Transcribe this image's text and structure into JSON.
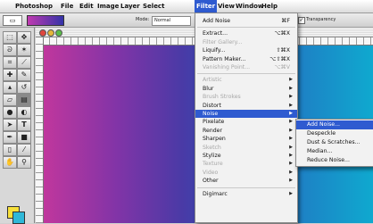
{
  "menubar": {
    "apple_icon": "apple-logo",
    "items": [
      "Photoshop",
      "File",
      "Edit",
      "Image",
      "Layer",
      "Select",
      "Filter",
      "View",
      "Window",
      "Help"
    ],
    "active": "Filter"
  },
  "options_bar": {
    "mode_label": "Mode:",
    "mode_value": "Normal",
    "checkbox_label": "Transparency",
    "checkbox_checked": true,
    "gradient_colors": [
      "#c03ab0",
      "#3433a8"
    ]
  },
  "toolbox": {
    "tool_icons": [
      "marquee-icon",
      "move-icon",
      "lasso-icon",
      "magic-wand-icon",
      "crop-icon",
      "slice-icon",
      "healing-icon",
      "brush-icon",
      "stamp-icon",
      "history-brush-icon",
      "eraser-icon",
      "gradient-icon",
      "blur-icon",
      "dodge-icon",
      "path-select-icon",
      "type-icon",
      "pen-icon",
      "shape-icon",
      "notes-icon",
      "eyedropper-icon",
      "hand-icon",
      "zoom-icon"
    ],
    "foreground_color": "#f7e03a",
    "background_color": "#2fb8d8"
  },
  "canvas": {
    "gradient_colors": [
      "#c0379d",
      "#4a3aa6",
      "#1f7cc4",
      "#0fa9cf"
    ]
  },
  "filter_menu": {
    "items": [
      {
        "label": "Add Noise",
        "shortcut": "⌘F",
        "disabled": false
      },
      {
        "sep": true
      },
      {
        "label": "Extract...",
        "shortcut": "⌥⌘X",
        "disabled": false
      },
      {
        "label": "Filter Gallery...",
        "shortcut": "",
        "disabled": true
      },
      {
        "label": "Liquify...",
        "shortcut": "⇧⌘X",
        "disabled": false
      },
      {
        "label": "Pattern Maker...",
        "shortcut": "⌥⇧⌘X",
        "disabled": false
      },
      {
        "label": "Vanishing Point...",
        "shortcut": "⌥⌘V",
        "disabled": true
      },
      {
        "sep": true
      },
      {
        "label": "Artistic",
        "submenu": true,
        "disabled": true
      },
      {
        "label": "Blur",
        "submenu": true,
        "disabled": false
      },
      {
        "label": "Brush Strokes",
        "submenu": true,
        "disabled": true
      },
      {
        "label": "Distort",
        "submenu": true,
        "disabled": false
      },
      {
        "label": "Noise",
        "submenu": true,
        "disabled": false,
        "highlight": true
      },
      {
        "label": "Pixelate",
        "submenu": true,
        "disabled": false
      },
      {
        "label": "Render",
        "submenu": true,
        "disabled": false
      },
      {
        "label": "Sharpen",
        "submenu": true,
        "disabled": false
      },
      {
        "label": "Sketch",
        "submenu": true,
        "disabled": true
      },
      {
        "label": "Stylize",
        "submenu": true,
        "disabled": false
      },
      {
        "label": "Texture",
        "submenu": true,
        "disabled": true
      },
      {
        "label": "Video",
        "submenu": true,
        "disabled": true
      },
      {
        "label": "Other",
        "submenu": true,
        "disabled": false
      },
      {
        "sep": true
      },
      {
        "label": "Digimarc",
        "submenu": true,
        "disabled": false
      }
    ]
  },
  "noise_submenu": {
    "items": [
      {
        "label": "Add Noise...",
        "highlight": true
      },
      {
        "label": "Despeckle",
        "highlight": false
      },
      {
        "label": "Dust & Scratches...",
        "highlight": false
      },
      {
        "label": "Median...",
        "highlight": false
      },
      {
        "label": "Reduce Noise...",
        "highlight": false
      }
    ]
  }
}
